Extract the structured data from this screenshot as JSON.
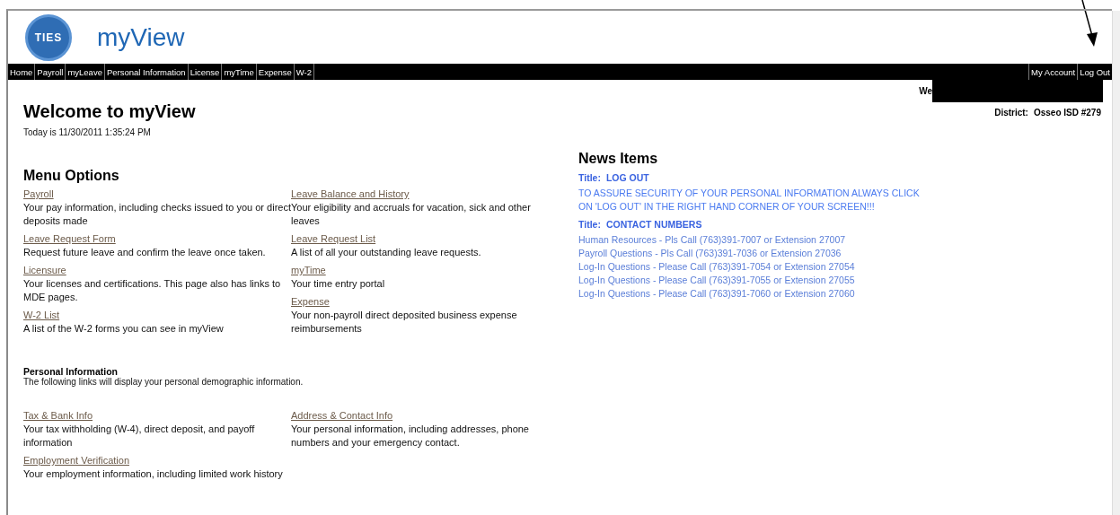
{
  "header": {
    "logo_text": "TIES",
    "app_title": "myView"
  },
  "nav": {
    "left": [
      "Home",
      "Payroll",
      "myLeave",
      "Personal Information",
      "License",
      "myTime",
      "Expense",
      "W-2"
    ],
    "right": [
      "My Account",
      "Log Out"
    ]
  },
  "user": {
    "greeting": "We"
  },
  "district": {
    "label": "District:",
    "value": "Osseo ISD #279"
  },
  "page": {
    "title": "Welcome to myView",
    "date": "Today is 11/30/2011 1:35:24 PM"
  },
  "menu_options": {
    "heading": "Menu Options",
    "columns": [
      [
        {
          "link": "Payroll",
          "description": "Your pay information, including checks issued to you or direct deposits made"
        },
        {
          "link": "Leave Request Form",
          "description": "Request future leave and confirm the leave once taken."
        },
        {
          "link": "Licensure",
          "description": "Your licenses and certifications. This page also has links to MDE pages."
        },
        {
          "link": "W-2 List",
          "description": "A list of the W-2 forms you can see in myView"
        }
      ],
      [
        {
          "link": "Leave Balance and History",
          "description": "Your eligibility and accruals for vacation, sick and other leaves"
        },
        {
          "link": "Leave Request List",
          "description": "A list of all your outstanding leave requests."
        },
        {
          "link": "myTime",
          "description": "Your time entry portal"
        },
        {
          "link": "Expense",
          "description": "Your non-payroll direct deposited business expense reimbursements"
        }
      ]
    ]
  },
  "personal_information": {
    "heading": "Personal Information",
    "description": "The following links will display your personal demographic information.",
    "columns": [
      [
        {
          "link": "Tax & Bank Info",
          "description": "Your tax withholding (W-4), direct deposit, and payoff information"
        },
        {
          "link": "Employment Verification",
          "description": "Your employment information, including limited work history"
        }
      ],
      [
        {
          "link": "Address & Contact Info",
          "description": "Your personal information, including addresses, phone numbers and your emergency contact."
        }
      ]
    ]
  },
  "news": {
    "heading": "News Items",
    "items": [
      {
        "kind": "paragraph",
        "title_label": "Title:",
        "title": "LOG OUT",
        "lines": [
          "TO ASSURE SECURITY OF YOUR PERSONAL INFORMATION ALWAYS CLICK ON 'LOG OUT' IN THE RIGHT HAND CORNER OF YOUR SCREEN!!!"
        ]
      },
      {
        "kind": "list",
        "title_label": "Title:",
        "title": "CONTACT NUMBERS",
        "lines": [
          "Human Resources - Pls Call (763)391-7007 or Extension 27007",
          "Payroll Questions - Pls Call (763)391-7036 or Extension 27036",
          "Log-In Questions - Please Call (763)391-7054 or Extension 27054",
          "Log-In Questions - Please Call (763)391-7055 or Extension 27055",
          "Log-In Questions - Please Call (763)391-7060 or Extension 27060"
        ]
      }
    ]
  }
}
